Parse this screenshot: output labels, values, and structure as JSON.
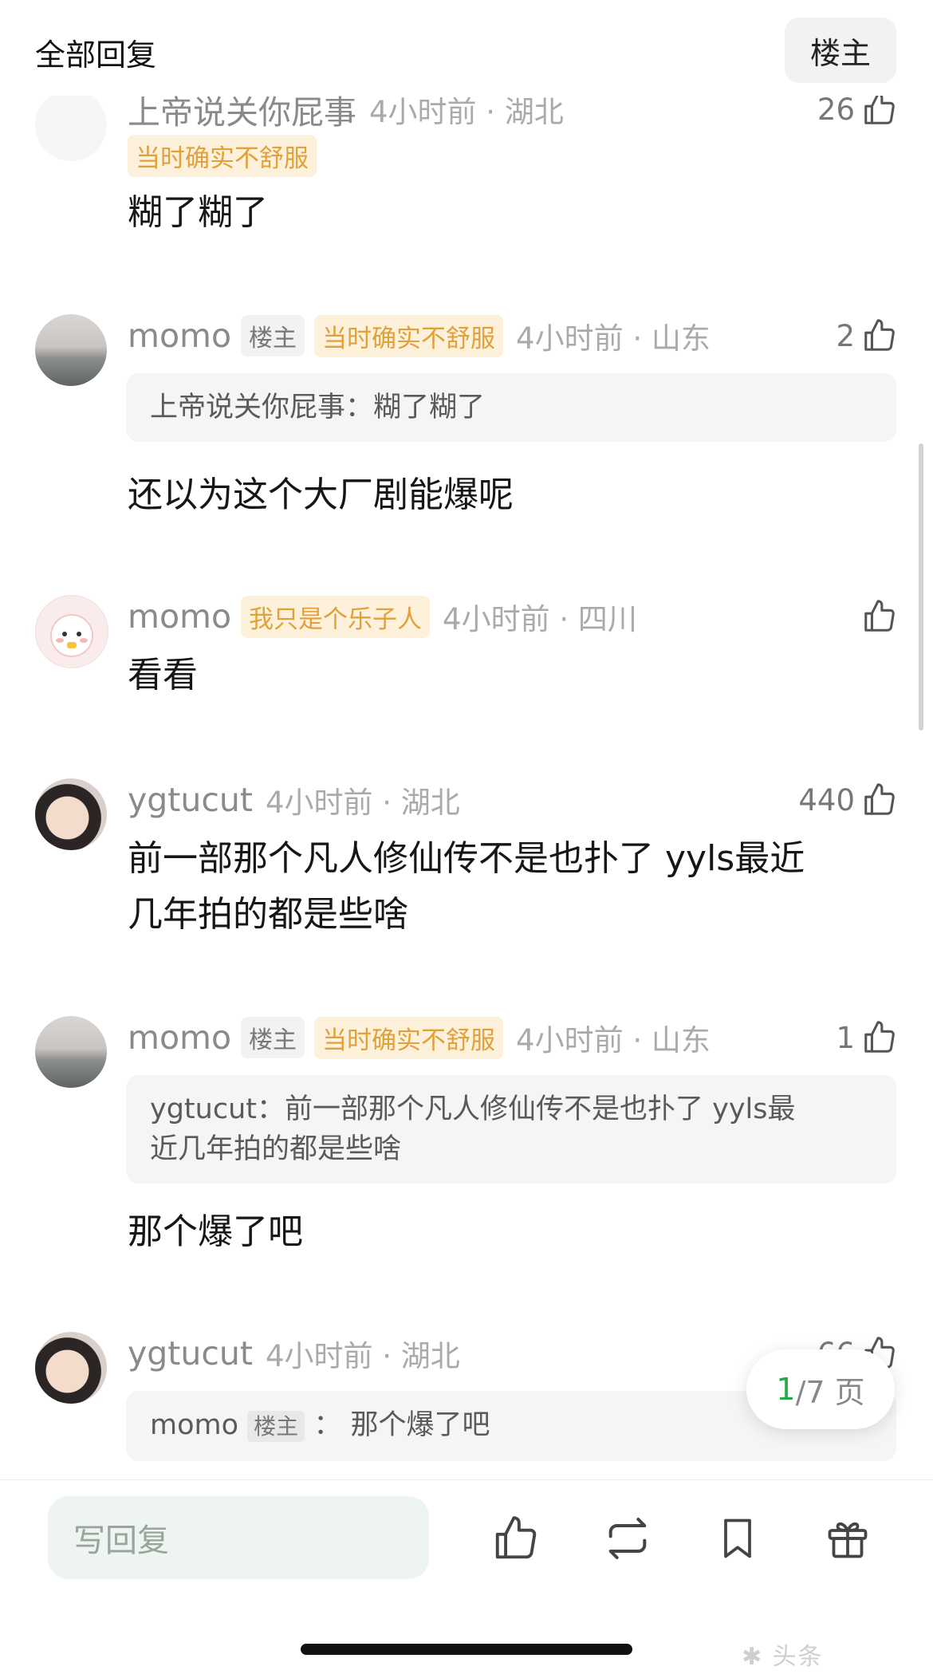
{
  "header": {
    "title": "全部回复",
    "op_filter": "楼主"
  },
  "comments": [
    {
      "username": "上帝说关你屁事",
      "tag": "当时确实不舒服",
      "time": "4小时前 · 湖北",
      "likes": "26",
      "text": "糊了糊了"
    },
    {
      "username": "momo",
      "op_badge": "楼主",
      "tag": "当时确实不舒服",
      "time": "4小时前 · 山东",
      "likes": "2",
      "quote": {
        "user": "上帝说关你屁事",
        "sep": "：",
        "text": "糊了糊了"
      },
      "text": "还以为这个大厂剧能爆呢"
    },
    {
      "username": "momo",
      "tag": "我只是个乐子人",
      "time": "4小时前 · 四川",
      "likes": "",
      "text": "看看"
    },
    {
      "username": "ygtucut",
      "time": "4小时前 · 湖北",
      "likes": "440",
      "text_line1": "前一部那个凡人修仙传不是也扑了 yyls最近",
      "text_line2": "几年拍的都是些啥"
    },
    {
      "username": "momo",
      "op_badge": "楼主",
      "tag": "当时确实不舒服",
      "time": "4小时前 · 山东",
      "likes": "1",
      "quote": {
        "user": "ygtucut",
        "sep": "：",
        "line1": "前一部那个凡人修仙传不是也扑了 yyls最",
        "line2": "近几年拍的都是些啥"
      },
      "text": "那个爆了吧"
    },
    {
      "username": "ygtucut",
      "time": "4小时前 · 湖北",
      "likes": "66",
      "quote": {
        "user": "momo",
        "op_badge": "楼主",
        "sep": "：",
        "text": "那个爆了吧"
      }
    }
  ],
  "pager": {
    "current": "1",
    "total": "/7 页"
  },
  "bottom": {
    "reply_placeholder": "写回复"
  },
  "colors": {
    "accent_green": "#2aa84a",
    "tag_text": "#e0a13a",
    "tag_bg": "#fdf1dc"
  },
  "icons": [
    "thumbs-up-icon",
    "repost-icon",
    "bookmark-icon",
    "gift-icon"
  ]
}
